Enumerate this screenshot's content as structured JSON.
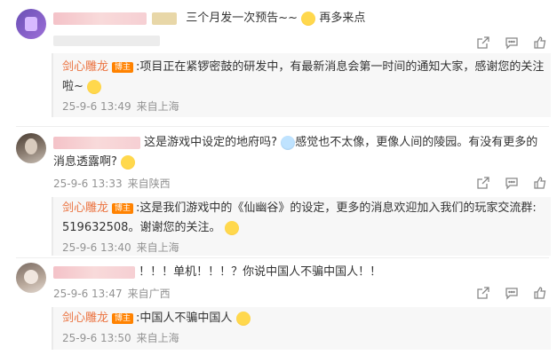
{
  "comments": [
    {
      "text": "三个月发一次预告~~",
      "text_after_emoji": "再多来点",
      "reply": {
        "author": "剑心雕龙",
        "badge": "博主",
        "line1": ":项目正在紧锣密鼓的研发中，有最新消息会第一时间的通知大家，感谢您的关注",
        "line2": "啦~",
        "date": "25-9-6 13:49",
        "location": "来自上海"
      }
    },
    {
      "text_line1": "这是游戏中设定的地府吗?",
      "text_line1b": "感觉也不太像，更像人间的陵园。有没有更多的",
      "text_line2": "消息透露啊?",
      "date": "25-9-6 13:33",
      "location": "来自陕西",
      "reply": {
        "author": "剑心雕龙",
        "badge": "博主",
        "line1": ":这是我们游戏中的《仙幽谷》的设定，更多的消息欢迎加入我们的玩家交流群:",
        "line2": "519632508。谢谢您的关注。",
        "date": "25-9-6 13:40",
        "location": "来自上海"
      }
    },
    {
      "text": "！！！单机！！！？你说中国人不骗中国人！！",
      "date": "25-9-6 13:47",
      "location": "来自广西",
      "reply": {
        "author": "剑心雕龙",
        "badge": "博主",
        "line1": ":中国人不骗中国人",
        "date": "25-9-6 13:50",
        "location": "来自上海"
      }
    }
  ],
  "icons": [
    "share-icon",
    "comment-icon",
    "like-icon"
  ]
}
